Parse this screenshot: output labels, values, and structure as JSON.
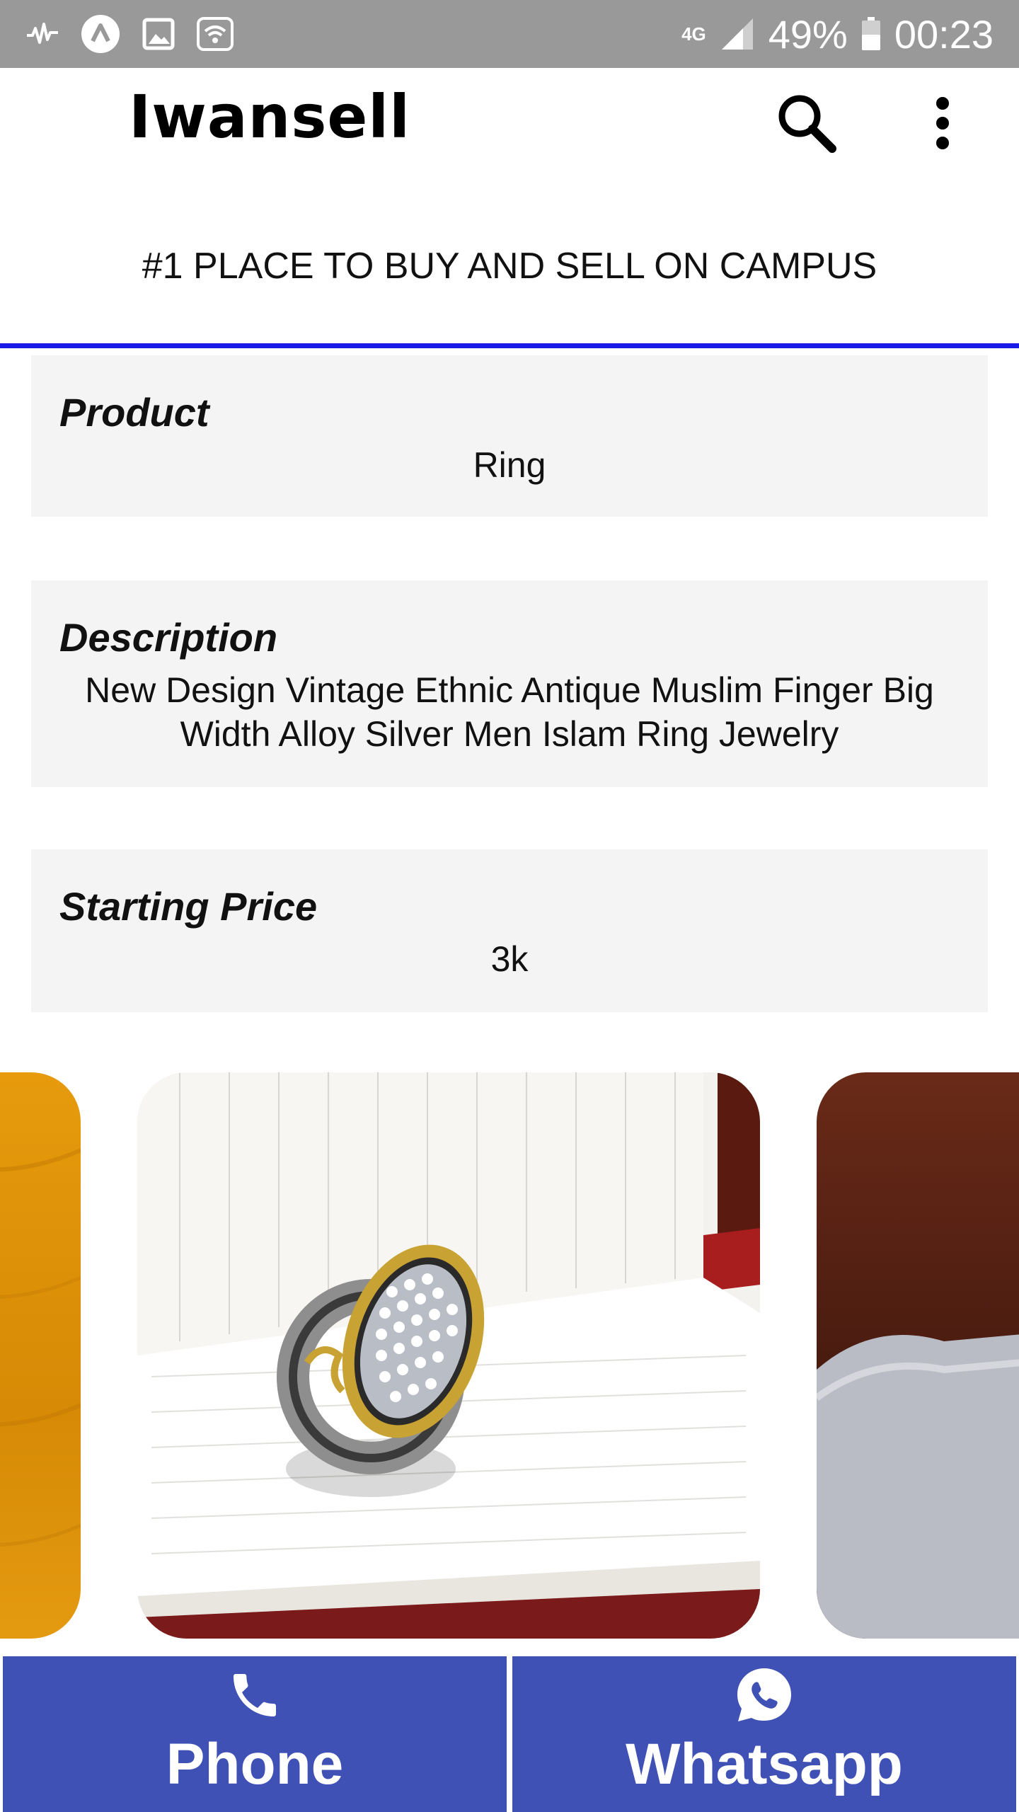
{
  "status_bar": {
    "network_label": "4G",
    "battery_percent": "49%",
    "time": "00:23",
    "icons": [
      "activity-icon",
      "app-a-icon",
      "gallery-icon",
      "wifi-icon",
      "network-4g-icon",
      "signal-icon",
      "battery-icon"
    ]
  },
  "app_bar": {
    "title": "Iwansell",
    "icons": [
      "search-icon",
      "more-vert-icon"
    ]
  },
  "tagline": "#1 PLACE TO BUY AND SELL ON CAMPUS",
  "product": {
    "label": "Product",
    "value": "Ring"
  },
  "description": {
    "label": "Description",
    "value": "New Design Vintage Ethnic Antique  Muslim Finger Big Width Alloy Silver Men Islam Ring Jewelry"
  },
  "price": {
    "label": "Starting Price",
    "value": "3k"
  },
  "carousel": {
    "slides": [
      "orange-wood-photo",
      "silver-ring-on-notebook-photo",
      "grey-felt-on-wood-photo"
    ]
  },
  "contact": {
    "phone_label": "Phone",
    "whatsapp_label": "Whatsapp",
    "icons": [
      "phone-icon",
      "whatsapp-icon"
    ]
  },
  "colors": {
    "status_bar": "#999999",
    "accent_line": "#1a1ae6",
    "card_background": "#f4f4f4",
    "contact_button": "#3f51b5"
  }
}
